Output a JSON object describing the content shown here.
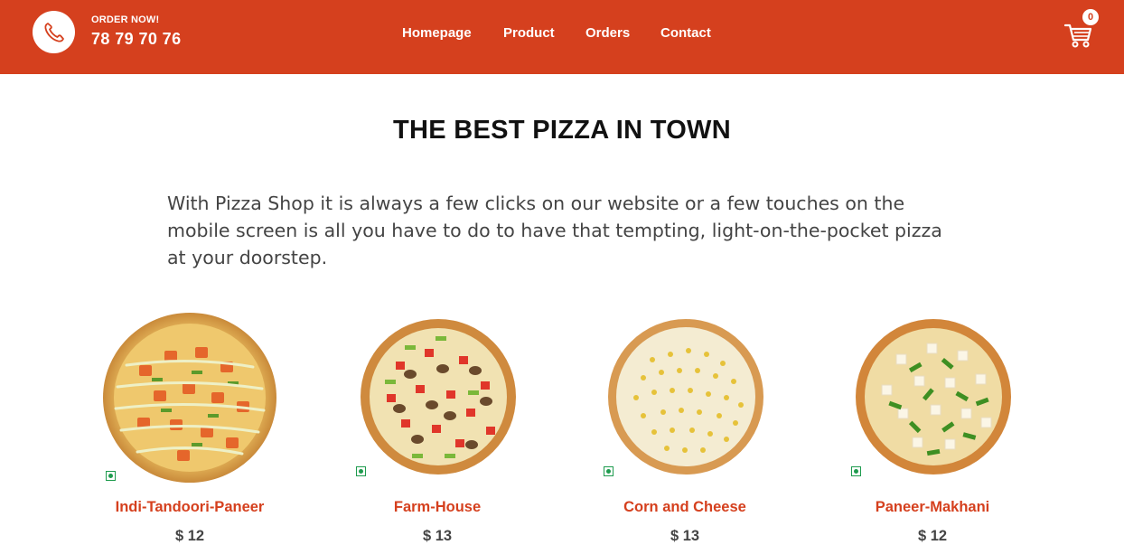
{
  "header": {
    "order_label": "ORDER NOW!",
    "phone": "78 79 70 76",
    "nav": [
      "Homepage",
      "Product",
      "Orders",
      "Contact"
    ],
    "cart_count": "0",
    "brand_color": "#d5401e"
  },
  "hero": {
    "title": "THE BEST PIZZA IN TOWN",
    "description": "With Pizza Shop it is always a few clicks on our website or a few touches on the mobile screen is all you have to do to have that tempting, light-on-the-pocket pizza at your doorstep."
  },
  "products": [
    {
      "name": "Indi-Tandoori-Paneer",
      "price": "$ 12",
      "veg": true
    },
    {
      "name": "Farm-House",
      "price": "$ 13",
      "veg": true
    },
    {
      "name": "Corn and Cheese",
      "price": "$ 13",
      "veg": true
    },
    {
      "name": "Paneer-Makhani",
      "price": "$ 12",
      "veg": true
    }
  ],
  "icons": {
    "phone": "phone-icon",
    "cart": "cart-icon",
    "veg": "veg-indicator-icon"
  },
  "colors": {
    "veg_green": "#1e9b4e",
    "text_dark": "#111111",
    "text_body": "#444444"
  }
}
